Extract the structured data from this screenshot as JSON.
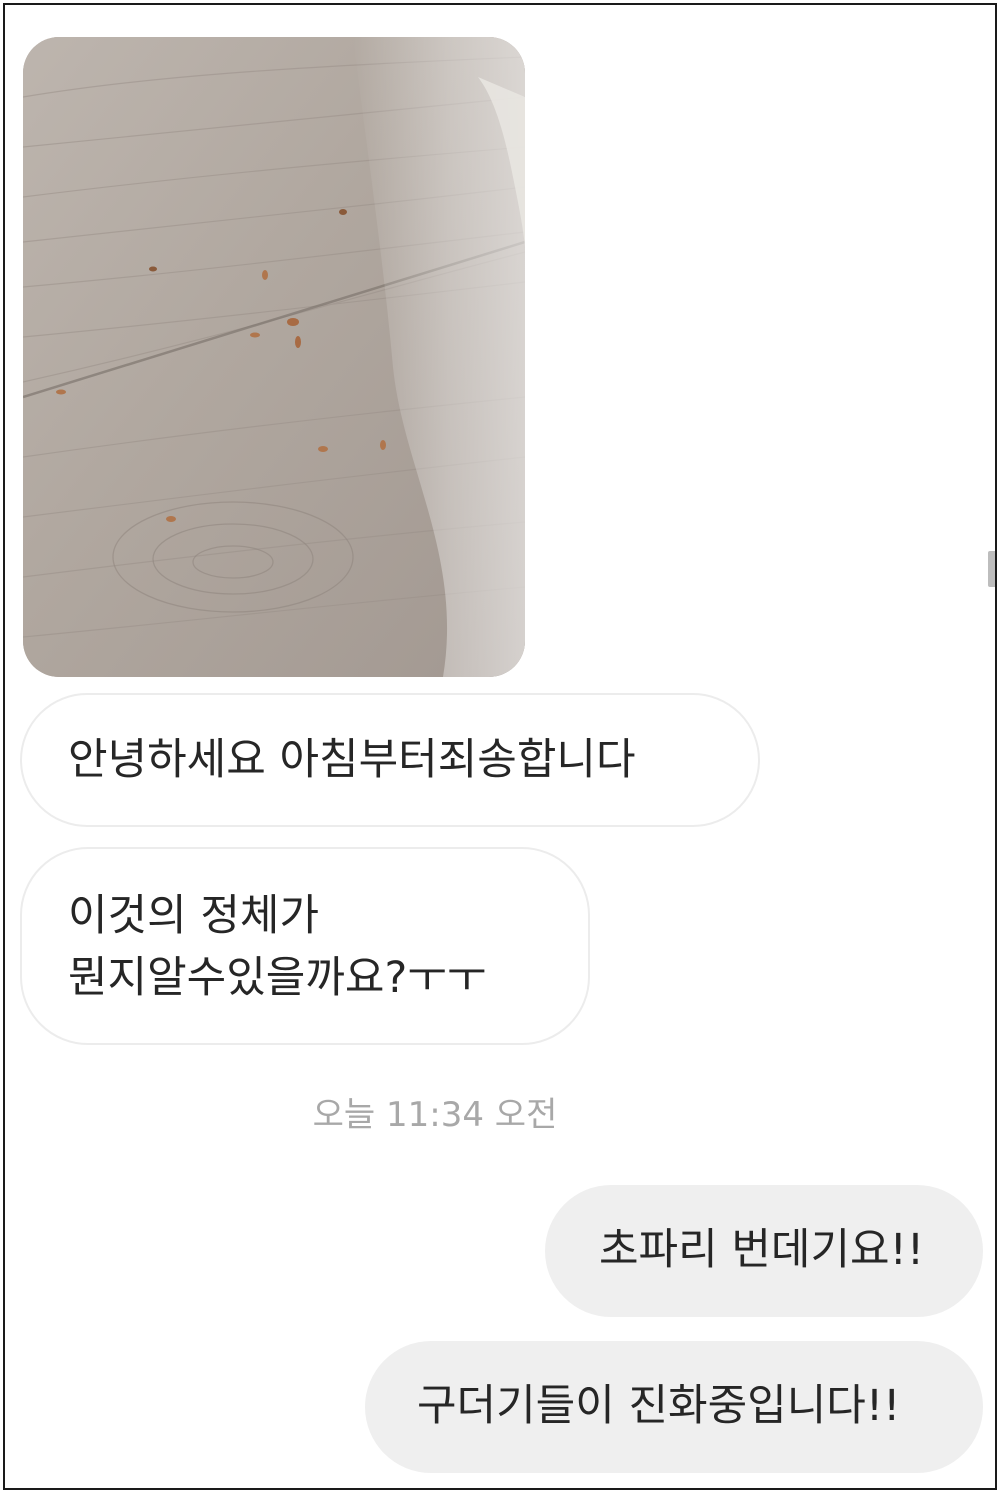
{
  "chat": {
    "image_attachment": {
      "icon": "photo-of-wooden-floor-with-larvae"
    },
    "messages_received": [
      {
        "text": "안녕하세요 아침부터죄송합니다"
      },
      {
        "lines": [
          "이것의 정체가",
          "뭔지알수있을까요?ㅜㅜ"
        ]
      }
    ],
    "timestamp": "오늘 11:34 오전",
    "messages_sent": [
      {
        "text": "초파리 번데기요!!"
      },
      {
        "text": "구더기들이 진화중입니다!!"
      }
    ]
  },
  "colors": {
    "received_bubble_bg": "#ffffff",
    "received_bubble_border": "#ececec",
    "sent_bubble_bg": "#efefef",
    "text": "#262626",
    "timestamp_text": "#a8a8a8"
  }
}
